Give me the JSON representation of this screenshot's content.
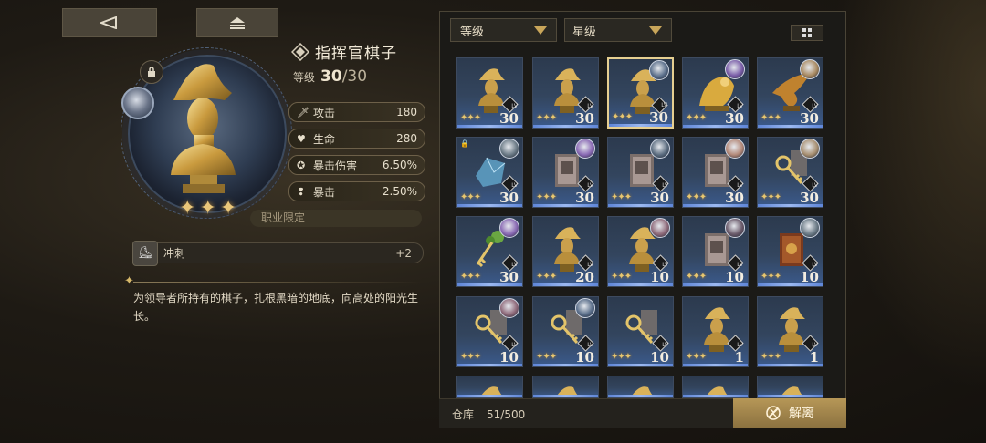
{
  "nav": {
    "back_icon": "back-arrow-icon",
    "menu_icon": "menu-icon"
  },
  "item": {
    "name": "指挥官棋子",
    "level_label": "等级",
    "level_value": "30",
    "level_max": "/30",
    "stars": 3,
    "stats": [
      {
        "icon": "sword-icon",
        "label": "攻击",
        "value": "180"
      },
      {
        "icon": "heart-icon",
        "label": "生命",
        "value": "280"
      },
      {
        "icon": "crit-damage-icon",
        "label": "暴击伤害",
        "value": "6.50%"
      },
      {
        "icon": "crit-icon",
        "label": "暴击",
        "value": "2.50%"
      }
    ],
    "restriction": "职业限定",
    "skill": {
      "label": "冲刺",
      "value": "+2"
    },
    "description": "为领导者所持有的棋子，扎根黑暗的地底，向高处的阳光生长。"
  },
  "filters": [
    {
      "label": "等级"
    },
    {
      "label": "星级"
    }
  ],
  "inventory": {
    "cards": [
      {
        "type": "bust",
        "level": "30",
        "stars": 3,
        "avatar": false,
        "lock": false,
        "selected": false
      },
      {
        "type": "bust",
        "level": "30",
        "stars": 3,
        "avatar": false,
        "lock": false,
        "selected": false
      },
      {
        "type": "bust",
        "level": "30",
        "stars": 3,
        "avatar": true,
        "avatar_color": "#5a6e8a",
        "lock": false,
        "selected": true
      },
      {
        "type": "dragon",
        "level": "30",
        "stars": 3,
        "avatar": true,
        "avatar_color": "#7a5ea8",
        "lock": false,
        "selected": false
      },
      {
        "type": "bird",
        "level": "30",
        "stars": 3,
        "avatar": true,
        "avatar_color": "#a98a62",
        "lock": false,
        "selected": false
      },
      {
        "type": "crystal",
        "level": "30",
        "stars": 3,
        "avatar": true,
        "avatar_color": "#6b7a86",
        "lock": true,
        "selected": false
      },
      {
        "type": "book",
        "level": "30",
        "stars": 3,
        "avatar": true,
        "avatar_color": "#8a6ab4",
        "lock": false,
        "selected": false
      },
      {
        "type": "book",
        "level": "30",
        "stars": 3,
        "avatar": true,
        "avatar_color": "#5c6d80",
        "lock": false,
        "selected": false
      },
      {
        "type": "book",
        "level": "30",
        "stars": 3,
        "avatar": true,
        "avatar_color": "#b48a7a",
        "lock": false,
        "selected": false
      },
      {
        "type": "key",
        "level": "30",
        "stars": 3,
        "avatar": true,
        "avatar_color": "#a89072",
        "lock": false,
        "selected": false
      },
      {
        "type": "greenkey",
        "level": "30",
        "stars": 3,
        "avatar": true,
        "avatar_color": "#8a6ab4",
        "lock": false,
        "selected": false
      },
      {
        "type": "bust",
        "level": "20",
        "stars": 3,
        "avatar": false,
        "lock": false,
        "selected": false
      },
      {
        "type": "bust",
        "level": "10",
        "stars": 3,
        "avatar": true,
        "avatar_color": "#8f6a7a",
        "lock": false,
        "selected": false
      },
      {
        "type": "book",
        "level": "10",
        "stars": 3,
        "avatar": true,
        "avatar_color": "#6a5a6a",
        "lock": false,
        "selected": false
      },
      {
        "type": "redbook",
        "level": "10",
        "stars": 3,
        "avatar": true,
        "avatar_color": "#6b7a86",
        "lock": false,
        "selected": false
      },
      {
        "type": "key",
        "level": "10",
        "stars": 3,
        "avatar": true,
        "avatar_color": "#8f6a7a",
        "lock": false,
        "selected": false
      },
      {
        "type": "key",
        "level": "10",
        "stars": 3,
        "avatar": true,
        "avatar_color": "#5a6e8a",
        "lock": false,
        "selected": false
      },
      {
        "type": "key",
        "level": "10",
        "stars": 3,
        "avatar": false,
        "lock": false,
        "selected": false
      },
      {
        "type": "bust",
        "level": "1",
        "stars": 3,
        "avatar": false,
        "lock": false,
        "selected": false
      },
      {
        "type": "bust",
        "level": "1",
        "stars": 3,
        "avatar": false,
        "lock": false,
        "selected": false
      },
      {
        "type": "bust",
        "level": "",
        "stars": 0,
        "avatar": false,
        "lock": false,
        "selected": false
      },
      {
        "type": "bust",
        "level": "",
        "stars": 0,
        "avatar": false,
        "lock": false,
        "selected": false
      },
      {
        "type": "bust",
        "level": "",
        "stars": 0,
        "avatar": false,
        "lock": false,
        "selected": false
      },
      {
        "type": "bust",
        "level": "",
        "stars": 0,
        "avatar": false,
        "lock": false,
        "selected": false
      },
      {
        "type": "bust",
        "level": "",
        "stars": 0,
        "avatar": false,
        "lock": false,
        "selected": false
      }
    ],
    "lv_tag": "LV",
    "storage_label": "仓库",
    "storage_count": "51/500",
    "release_label": "解离"
  },
  "colors": {
    "accent_gold": "#c9a65a",
    "card_blue": "#3b5a8c",
    "release_button": "#a8894f"
  }
}
